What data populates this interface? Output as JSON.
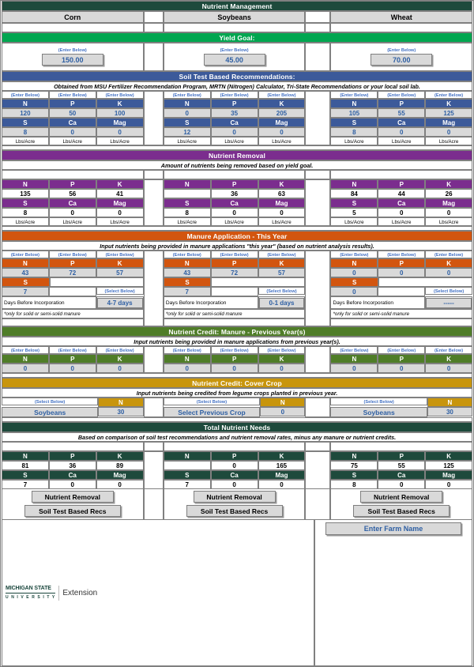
{
  "title": "Nutrient Management",
  "crops": [
    "Corn",
    "Soybeans",
    "Wheat"
  ],
  "labels": {
    "enter_below": "(Enter Below)",
    "select_below": "(Select Below)",
    "lbs_acre": "Lbs/Acre",
    "n": "N",
    "p": "P",
    "k": "K",
    "s": "S",
    "ca": "Ca",
    "mag": "Mag",
    "days_before_incorporation": "Days Before Incorporation",
    "manure_footnote": "*only for solid or semi-solid manure"
  },
  "yield_goal": {
    "band": "Yield Goal:",
    "values": [
      "150.00",
      "45.00",
      "70.00"
    ]
  },
  "soil_test": {
    "band": "Soil Test Based Recommendations:",
    "note": "Obtained from MSU Fertilizer Recommendation Program, MRTN (Nitrogen) Calculator, Tri-State Recommendations or your local soil lab.",
    "columns": [
      {
        "n": "120",
        "p": "50",
        "k": "100",
        "s": "8",
        "ca": "0",
        "mag": "0"
      },
      {
        "n": "0",
        "p": "35",
        "k": "205",
        "s": "12",
        "ca": "0",
        "mag": "0"
      },
      {
        "n": "105",
        "p": "55",
        "k": "125",
        "s": "8",
        "ca": "0",
        "mag": "0"
      }
    ]
  },
  "nutrient_removal": {
    "band": "Nutrient Removal",
    "note": "Amount of nutrients being removed based on yield goal.",
    "columns": [
      {
        "n": "135",
        "p": "56",
        "k": "41",
        "s": "8",
        "ca": "0",
        "mag": "0"
      },
      {
        "n": "",
        "p": "36",
        "k": "63",
        "s": "8",
        "ca": "0",
        "mag": "0"
      },
      {
        "n": "84",
        "p": "44",
        "k": "26",
        "s": "5",
        "ca": "0",
        "mag": "0"
      }
    ]
  },
  "manure_this_year": {
    "band": "Manure  Application - This Year",
    "note": "Input nutrients being provided in manure applications \"this year\" (based on nutrient analysis results).",
    "columns": [
      {
        "n": "43",
        "p": "72",
        "k": "57",
        "s": "7",
        "days": "4-7 days"
      },
      {
        "n": "43",
        "p": "72",
        "k": "57",
        "s": "7",
        "days": "0-1 days"
      },
      {
        "n": "0",
        "p": "0",
        "k": "0",
        "s": "0",
        "days": "-----"
      }
    ]
  },
  "manure_credit": {
    "band": "Nutrient Credit: Manure - Previous Year(s)",
    "note": "Input nutrients being provided in manure applications from previous year(s).",
    "columns": [
      {
        "n": "0",
        "p": "0",
        "k": "0"
      },
      {
        "n": "0",
        "p": "0",
        "k": "0"
      },
      {
        "n": "0",
        "p": "0",
        "k": "0"
      }
    ]
  },
  "cover_crop": {
    "band": "Nutrient Credit: Cover Crop",
    "note": "Input nutrients being credited from legume crops planted in previous year.",
    "columns": [
      {
        "crop": "Soybeans",
        "n": "30"
      },
      {
        "crop": "Select Previous Crop",
        "n": "0"
      },
      {
        "crop": "Soybeans",
        "n": "30"
      }
    ]
  },
  "total_needs": {
    "band": "Total Nutrient Needs",
    "note": "Based on comparison of soil test recommendations and nutrient removal rates, minus any manure or nutrient credits.",
    "columns": [
      {
        "n": "81",
        "p": "36",
        "k": "89",
        "s": "7",
        "ca": "0",
        "mag": "0"
      },
      {
        "n": "",
        "p": "0",
        "k": "165",
        "s": "7",
        "ca": "0",
        "mag": "0"
      },
      {
        "n": "75",
        "p": "55",
        "k": "125",
        "s": "8",
        "ca": "0",
        "mag": "0"
      }
    ]
  },
  "buttons": {
    "nutrient_removal": "Nutrient Removal",
    "soil_test_recs": "Soil Test Based Recs"
  },
  "footer": {
    "logo_line1": "MICHIGAN STATE",
    "logo_line2": "U N I V E R S I T Y",
    "logo_word": "Extension",
    "farm_name": "Enter Farm Name"
  },
  "colors": {
    "title_green": "#1e4a3c",
    "yield_green": "#00a650",
    "soil_blue": "#3c5a9a",
    "removal_purple": "#7b2d8e",
    "manure_orange": "#d2550f",
    "credit_olive": "#4f7d28",
    "cover_gold": "#c8950c",
    "value_blue": "#2e5fa3"
  }
}
